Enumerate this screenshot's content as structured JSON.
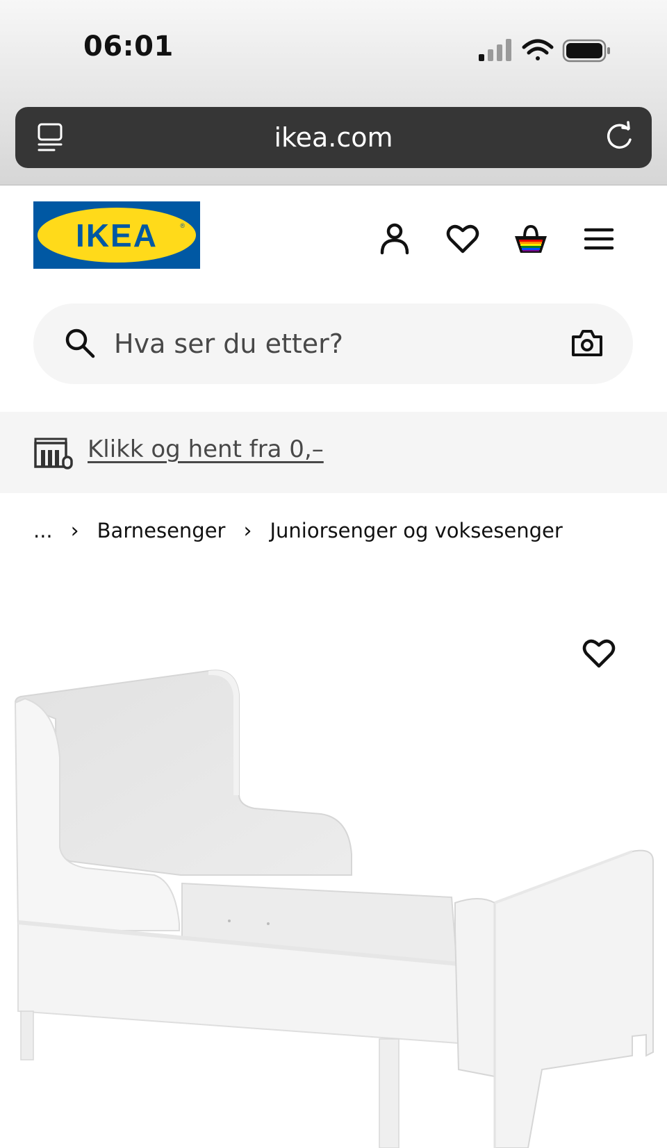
{
  "status_bar": {
    "time": "06:01"
  },
  "browser": {
    "url": "ikea.com"
  },
  "header": {
    "logo_text": "IKEA",
    "logo_colors": {
      "blue": "#0058a3",
      "yellow": "#ffda1a"
    },
    "icons": [
      "profile-icon",
      "heart-icon",
      "shopping-bag-icon",
      "menu-icon"
    ]
  },
  "search": {
    "placeholder": "Hva ser du etter?"
  },
  "promo": {
    "link_text": "Klikk og hent fra 0,–"
  },
  "breadcrumb": {
    "ellipsis": "...",
    "items": [
      "Barnesenger",
      "Juniorsenger og voksesenger"
    ]
  },
  "product": {
    "image": "white extendable junior bed"
  }
}
